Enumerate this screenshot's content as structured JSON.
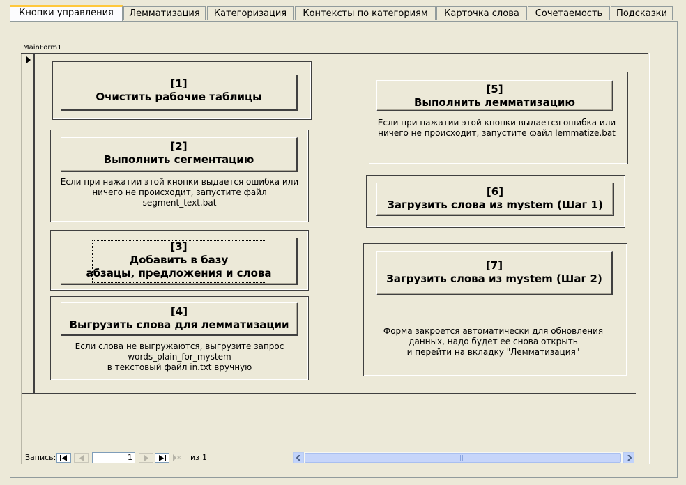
{
  "tabs": [
    {
      "label": "Кнопки управления",
      "active": true
    },
    {
      "label": "Лемматизация",
      "active": false
    },
    {
      "label": "Категоризация",
      "active": false
    },
    {
      "label": "Контексты по категориям",
      "active": false
    },
    {
      "label": "Карточка слова",
      "active": false
    },
    {
      "label": "Сочетаемость",
      "active": false
    },
    {
      "label": "Подсказки",
      "active": false
    }
  ],
  "form": {
    "label": "MainForm1"
  },
  "buttons": {
    "b1": {
      "num": "[1]",
      "label": "Очистить рабочие таблицы"
    },
    "b2": {
      "num": "[2]",
      "label": "Выполнить сегментацию",
      "note1": "Если при нажатии этой кнопки выдается ошибка или",
      "note2": "ничего не происходит, запустите файл segment_text.bat"
    },
    "b3": {
      "num": "[3]",
      "label1": "Добавить в базу",
      "label2": "абзацы, предложения и слова"
    },
    "b4": {
      "num": "[4]",
      "label": "Выгрузить слова для лемматизации",
      "note1": "Если слова не выгружаются, выгрузите запрос",
      "note2": "words_plain_for_mystem",
      "note3": "в текстовый файл in.txt вручную"
    },
    "b5": {
      "num": "[5]",
      "label": "Выполнить лемматизацию",
      "note1": "Если при нажатии этой кнопки выдается ошибка или",
      "note2": "ничего не происходит, запустите файл lemmatize.bat"
    },
    "b6": {
      "num": "[6]",
      "label": "Загрузить слова из mystem (Шаг 1)"
    },
    "b7": {
      "num": "[7]",
      "label": "Загрузить слова из mystem (Шаг 2)",
      "note1": "Форма закроется автоматически для обновления",
      "note2": "данных, надо будет ее снова открыть",
      "note3": "и перейти на вкладку \"Лемматизация\""
    }
  },
  "navigator": {
    "record_label": "Запись:",
    "current": "1",
    "of_label": "из",
    "total": "1"
  },
  "colors": {
    "background": "#ECE9D8",
    "active_tab_accent": "#FFC83C",
    "scrollbar": "#C1D3FB"
  }
}
